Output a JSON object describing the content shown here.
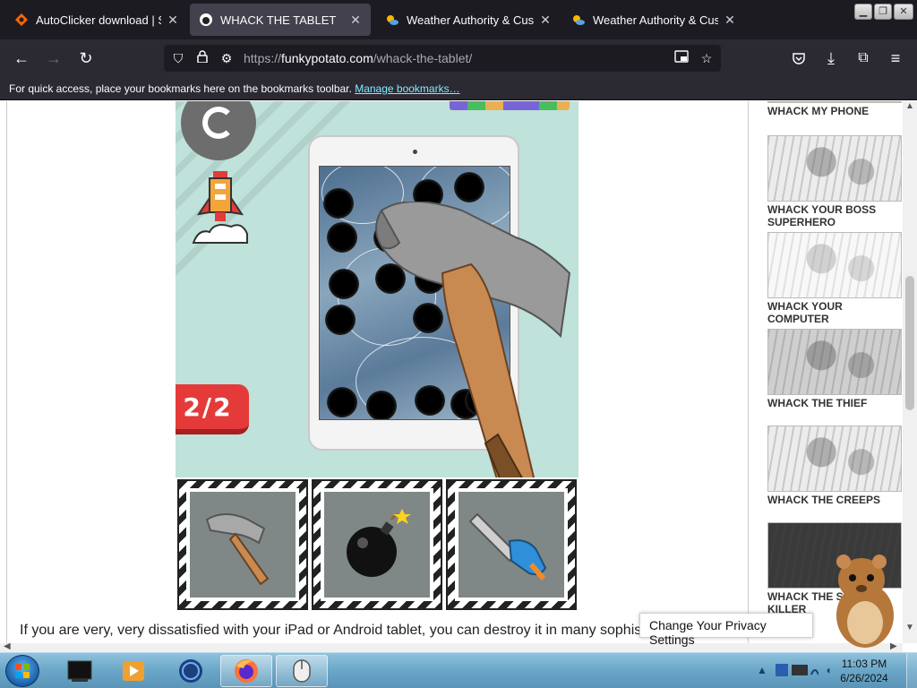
{
  "tabs": [
    {
      "title": "AutoClicker download | Sour",
      "icon": "sourceforge-icon",
      "active": false
    },
    {
      "title": "WHACK THE TABLET",
      "icon": "potato-icon",
      "active": true
    },
    {
      "title": "Weather Authority & Custo",
      "icon": "weather-icon",
      "active": false
    },
    {
      "title": "Weather Authority & Custo",
      "icon": "weather-icon",
      "active": false
    }
  ],
  "nav": {
    "url_prefix": "https://",
    "url_domain": "funkypotato.com",
    "url_path": "/whack-the-tablet/"
  },
  "bookmarks": {
    "text": "For quick access, place your bookmarks here on the bookmarks toolbar.",
    "link": "Manage bookmarks…"
  },
  "game": {
    "counter": "2/2",
    "tools": [
      "hammer",
      "bomb",
      "chainsaw"
    ]
  },
  "article": {
    "text": "If you are very, very dissatisfied with your iPad or Android tablet, you can destroy it in many sophis"
  },
  "sidebar": {
    "items": [
      {
        "title": "WHACK MY PHONE"
      },
      {
        "title": "WHACK YOUR BOSS SUPERHERO"
      },
      {
        "title": "WHACK YOUR COMPUTER"
      },
      {
        "title": "WHACK THE THIEF"
      },
      {
        "title": "WHACK THE CREEPS"
      },
      {
        "title": "WHACK THE SERIAL KILLER"
      }
    ]
  },
  "privacy": {
    "label": "Change Your Privacy Settings"
  },
  "taskbar": {
    "time": "11:03 PM",
    "date": "6/26/2024"
  },
  "colors": {
    "browser_dark": "#1c1b22",
    "toolbar": "#2b2a33",
    "game_bg": "#bfe2da",
    "counter_red": "#e53a3a",
    "link": "#80ebff"
  }
}
